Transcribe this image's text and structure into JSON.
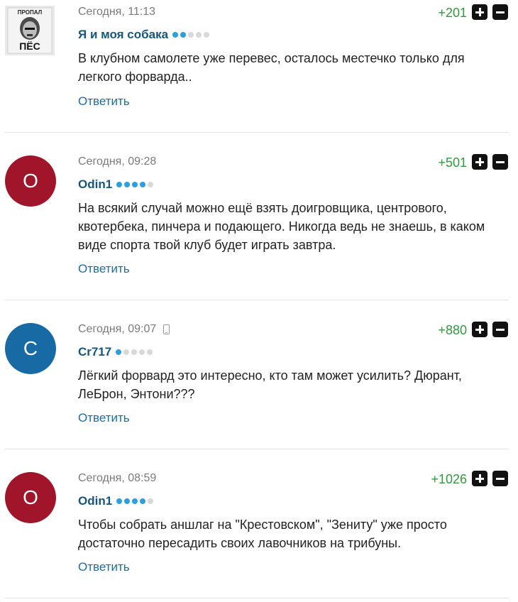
{
  "comments": [
    {
      "date": "Сегодня, 11:13",
      "user": "Я и моя собака",
      "rating": 2,
      "score": "+201",
      "text": "В клубном самолете уже перевес, осталось местечко только для легкого форварда..",
      "reply": "Ответить",
      "avatar": {
        "type": "image",
        "top_text": "ПРОПАЛ",
        "bottom_text": "ПЁС"
      }
    },
    {
      "date": "Сегодня, 09:28",
      "user": "Odin1",
      "rating": 4,
      "score": "+501",
      "text": "На всякий случай можно ещё взять доигровщика, центрового, квотербека, пинчера и подающего. Никогда ведь не знаешь, в каком виде спорта твой клуб будет играть завтра.",
      "reply": "Ответить",
      "avatar": {
        "type": "letter",
        "letter": "O",
        "color": "#a0152a"
      }
    },
    {
      "date": "Сегодня, 09:07",
      "user": "Cr717",
      "rating": 1,
      "score": "+880",
      "text": "Лёгкий форвард это интересно, кто там может усилить? Дюрант, ЛеБрон, Энтони???",
      "reply": "Ответить",
      "mobile": true,
      "avatar": {
        "type": "letter",
        "letter": "C",
        "color": "#176aa3"
      }
    },
    {
      "date": "Сегодня, 08:59",
      "user": "Odin1",
      "rating": 4,
      "score": "+1026",
      "text": "Чтобы собрать аншлаг на \"Крестовском\", \"Зениту\" уже просто достаточно пересадить своих лавочников на трибуны.",
      "reply": "Ответить",
      "avatar": {
        "type": "letter",
        "letter": "O",
        "color": "#a0152a"
      }
    }
  ],
  "icons": {
    "upvote": "plus-icon",
    "downvote": "minus-icon",
    "mobile": "phone-icon"
  }
}
